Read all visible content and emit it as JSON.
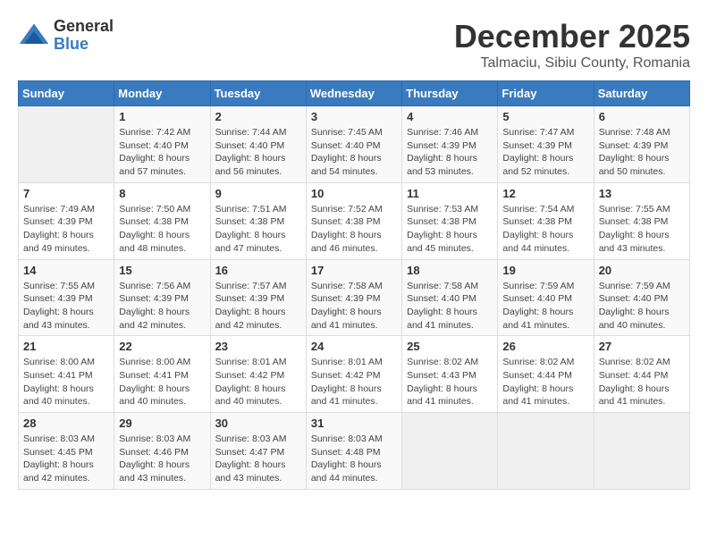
{
  "logo": {
    "general": "General",
    "blue": "Blue"
  },
  "title": "December 2025",
  "subtitle": "Talmaciu, Sibiu County, Romania",
  "days_of_week": [
    "Sunday",
    "Monday",
    "Tuesday",
    "Wednesday",
    "Thursday",
    "Friday",
    "Saturday"
  ],
  "weeks": [
    [
      {
        "day": "",
        "info": ""
      },
      {
        "day": "1",
        "info": "Sunrise: 7:42 AM\nSunset: 4:40 PM\nDaylight: 8 hours\nand 57 minutes."
      },
      {
        "day": "2",
        "info": "Sunrise: 7:44 AM\nSunset: 4:40 PM\nDaylight: 8 hours\nand 56 minutes."
      },
      {
        "day": "3",
        "info": "Sunrise: 7:45 AM\nSunset: 4:40 PM\nDaylight: 8 hours\nand 54 minutes."
      },
      {
        "day": "4",
        "info": "Sunrise: 7:46 AM\nSunset: 4:39 PM\nDaylight: 8 hours\nand 53 minutes."
      },
      {
        "day": "5",
        "info": "Sunrise: 7:47 AM\nSunset: 4:39 PM\nDaylight: 8 hours\nand 52 minutes."
      },
      {
        "day": "6",
        "info": "Sunrise: 7:48 AM\nSunset: 4:39 PM\nDaylight: 8 hours\nand 50 minutes."
      }
    ],
    [
      {
        "day": "7",
        "info": "Sunrise: 7:49 AM\nSunset: 4:39 PM\nDaylight: 8 hours\nand 49 minutes."
      },
      {
        "day": "8",
        "info": "Sunrise: 7:50 AM\nSunset: 4:38 PM\nDaylight: 8 hours\nand 48 minutes."
      },
      {
        "day": "9",
        "info": "Sunrise: 7:51 AM\nSunset: 4:38 PM\nDaylight: 8 hours\nand 47 minutes."
      },
      {
        "day": "10",
        "info": "Sunrise: 7:52 AM\nSunset: 4:38 PM\nDaylight: 8 hours\nand 46 minutes."
      },
      {
        "day": "11",
        "info": "Sunrise: 7:53 AM\nSunset: 4:38 PM\nDaylight: 8 hours\nand 45 minutes."
      },
      {
        "day": "12",
        "info": "Sunrise: 7:54 AM\nSunset: 4:38 PM\nDaylight: 8 hours\nand 44 minutes."
      },
      {
        "day": "13",
        "info": "Sunrise: 7:55 AM\nSunset: 4:38 PM\nDaylight: 8 hours\nand 43 minutes."
      }
    ],
    [
      {
        "day": "14",
        "info": "Sunrise: 7:55 AM\nSunset: 4:39 PM\nDaylight: 8 hours\nand 43 minutes."
      },
      {
        "day": "15",
        "info": "Sunrise: 7:56 AM\nSunset: 4:39 PM\nDaylight: 8 hours\nand 42 minutes."
      },
      {
        "day": "16",
        "info": "Sunrise: 7:57 AM\nSunset: 4:39 PM\nDaylight: 8 hours\nand 42 minutes."
      },
      {
        "day": "17",
        "info": "Sunrise: 7:58 AM\nSunset: 4:39 PM\nDaylight: 8 hours\nand 41 minutes."
      },
      {
        "day": "18",
        "info": "Sunrise: 7:58 AM\nSunset: 4:40 PM\nDaylight: 8 hours\nand 41 minutes."
      },
      {
        "day": "19",
        "info": "Sunrise: 7:59 AM\nSunset: 4:40 PM\nDaylight: 8 hours\nand 41 minutes."
      },
      {
        "day": "20",
        "info": "Sunrise: 7:59 AM\nSunset: 4:40 PM\nDaylight: 8 hours\nand 40 minutes."
      }
    ],
    [
      {
        "day": "21",
        "info": "Sunrise: 8:00 AM\nSunset: 4:41 PM\nDaylight: 8 hours\nand 40 minutes."
      },
      {
        "day": "22",
        "info": "Sunrise: 8:00 AM\nSunset: 4:41 PM\nDaylight: 8 hours\nand 40 minutes."
      },
      {
        "day": "23",
        "info": "Sunrise: 8:01 AM\nSunset: 4:42 PM\nDaylight: 8 hours\nand 40 minutes."
      },
      {
        "day": "24",
        "info": "Sunrise: 8:01 AM\nSunset: 4:42 PM\nDaylight: 8 hours\nand 41 minutes."
      },
      {
        "day": "25",
        "info": "Sunrise: 8:02 AM\nSunset: 4:43 PM\nDaylight: 8 hours\nand 41 minutes."
      },
      {
        "day": "26",
        "info": "Sunrise: 8:02 AM\nSunset: 4:44 PM\nDaylight: 8 hours\nand 41 minutes."
      },
      {
        "day": "27",
        "info": "Sunrise: 8:02 AM\nSunset: 4:44 PM\nDaylight: 8 hours\nand 41 minutes."
      }
    ],
    [
      {
        "day": "28",
        "info": "Sunrise: 8:03 AM\nSunset: 4:45 PM\nDaylight: 8 hours\nand 42 minutes."
      },
      {
        "day": "29",
        "info": "Sunrise: 8:03 AM\nSunset: 4:46 PM\nDaylight: 8 hours\nand 43 minutes."
      },
      {
        "day": "30",
        "info": "Sunrise: 8:03 AM\nSunset: 4:47 PM\nDaylight: 8 hours\nand 43 minutes."
      },
      {
        "day": "31",
        "info": "Sunrise: 8:03 AM\nSunset: 4:48 PM\nDaylight: 8 hours\nand 44 minutes."
      },
      {
        "day": "",
        "info": ""
      },
      {
        "day": "",
        "info": ""
      },
      {
        "day": "",
        "info": ""
      }
    ]
  ]
}
